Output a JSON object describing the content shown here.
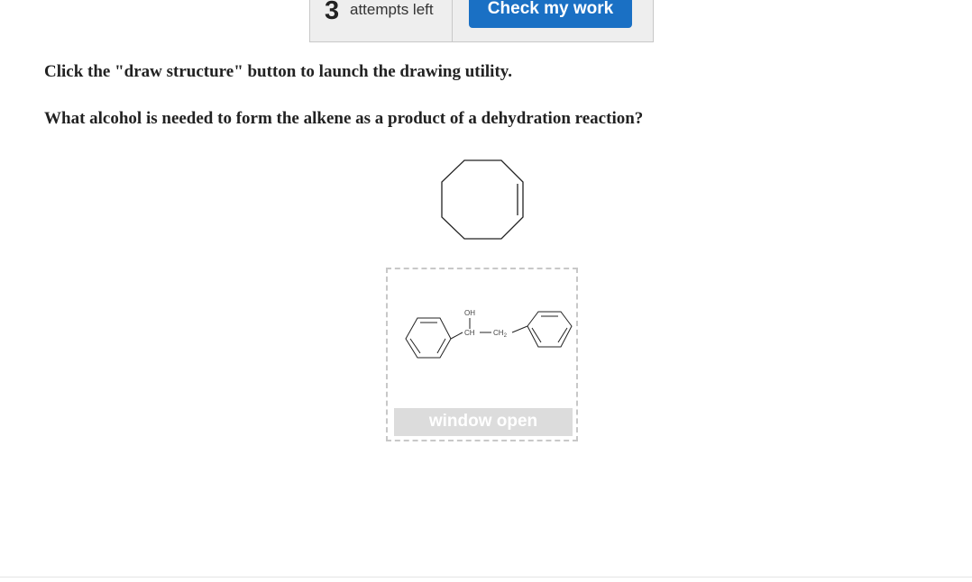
{
  "attempts": {
    "count": "3",
    "label": "attempts left"
  },
  "check_button": {
    "label": "Check my work"
  },
  "instruction": "Click the \"draw structure\" button to launch the drawing utility.",
  "question": "What alcohol is needed to form the alkene as a product of a dehydration reaction?",
  "draw_box": {
    "button_label": "window open",
    "molecule_labels": {
      "hydroxyl": "OH",
      "methine": "CH",
      "methylene": "CH",
      "methylene_subscript": "2"
    }
  },
  "colors": {
    "button_blue": "#1a70c4",
    "disabled_gray": "#dcdcdc",
    "border_gray": "#c8c8c8"
  }
}
